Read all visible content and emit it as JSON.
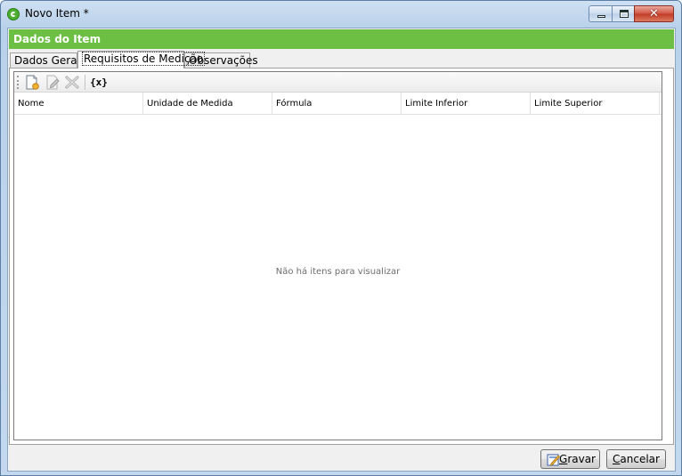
{
  "window": {
    "title": "Novo Item *",
    "close_glyph": "✕"
  },
  "group": {
    "title": "Dados do Item"
  },
  "tabs": [
    {
      "label": "Dados Gerais"
    },
    {
      "label": "Requisitos de Medição"
    },
    {
      "label": "Observações"
    }
  ],
  "toolbar": {
    "formula_label": "{x}",
    "icons": [
      "new-record-icon",
      "edit-icon",
      "delete-icon",
      "formula-icon"
    ]
  },
  "grid": {
    "columns": [
      "Nome",
      "Unidade de Medida",
      "Fórmula",
      "Limite Inferior",
      "Limite Superior"
    ],
    "empty_message": "Não há itens para visualizar"
  },
  "footer": {
    "save_mnemonic": "G",
    "save_rest": "ravar",
    "cancel_mnemonic": "C",
    "cancel_rest": "ancelar"
  },
  "colors": {
    "group_header": "#6cbf43",
    "close_button": "#c13a26"
  }
}
